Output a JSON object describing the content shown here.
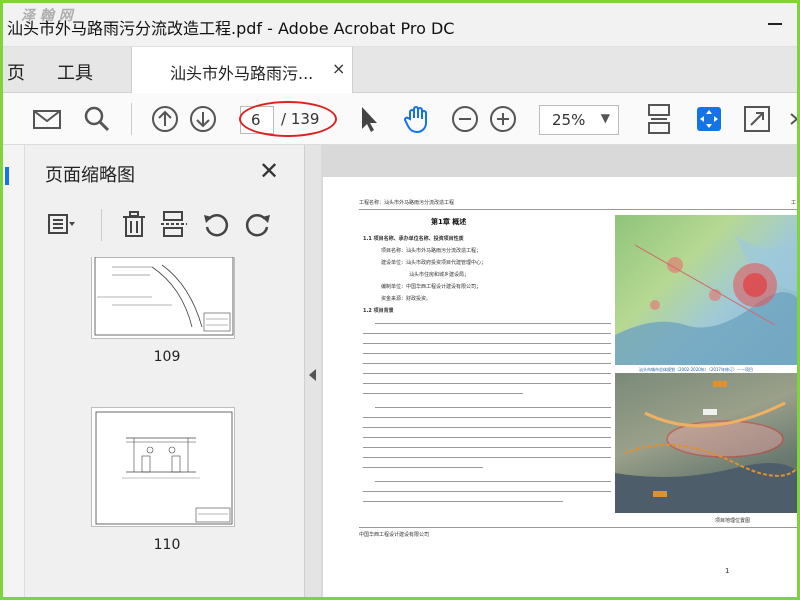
{
  "window": {
    "title": "汕头市外马路雨污分流改造工程.pdf - Adobe Acrobat Pro DC",
    "watermark": "泽 翰 网"
  },
  "tabs": {
    "menu_items": [
      "页",
      "工具"
    ],
    "active_tab_label": "汕头市外马路雨污...",
    "close_glyph": "×"
  },
  "toolbar": {
    "current_page": "6",
    "total_pages": "/ 139",
    "zoom": "25%",
    "icons": [
      "mail-icon",
      "search-icon",
      "prev-page-icon",
      "next-page-icon",
      "select-cursor-icon",
      "hand-tool-icon",
      "zoom-out-icon",
      "zoom-in-icon",
      "fit-page-icon",
      "fit-width-icon",
      "fullscreen-icon"
    ]
  },
  "thumbnails": {
    "title": "页面缩略图",
    "close_glyph": "✕",
    "pages": [
      {
        "number": "109"
      },
      {
        "number": "110"
      }
    ]
  },
  "document": {
    "header_left": "工程名称：汕头市外马路雨污分流改造工程",
    "header_right": "工",
    "chapter": "第1章 概述",
    "section1": "1.1 项目名称、承办单位名称、投资项目性质",
    "lines1": [
      "项目名称：汕头市外马路雨污分流改造工程；",
      "建设单位：汕头市政府投资项目代建管理中心；",
      "汕头市住房和城乡建设局；",
      "编制单位：中国华西工程设计建设有限公司；",
      "资金来源：财政投资。"
    ],
    "section2": "1.2 项目背景",
    "map1_caption": "汕头市城市总体规划（2002-2020年）（2017年修订）——项目",
    "map2_caption": "项目地理位置图",
    "footer_left": "中国华西工程设计建设有限公司",
    "page_number": "1"
  }
}
